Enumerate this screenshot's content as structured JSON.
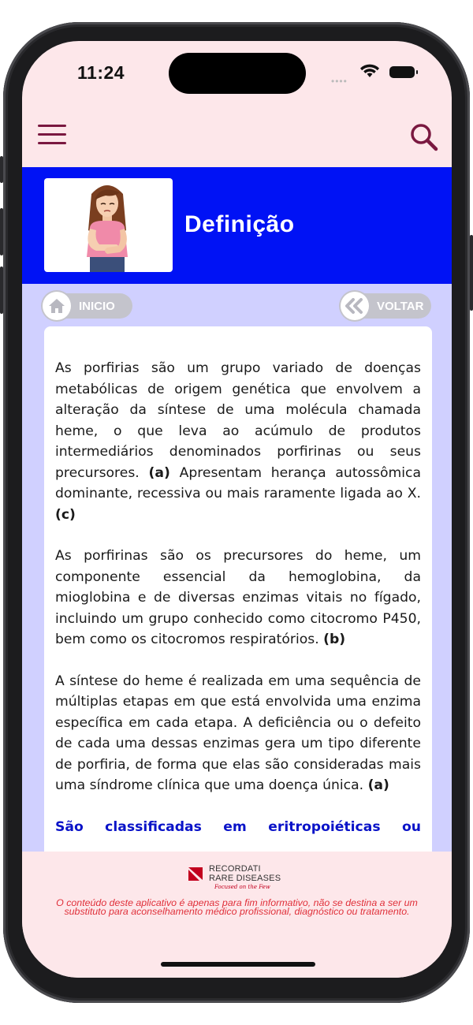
{
  "status_bar": {
    "time": "11:24"
  },
  "header": {
    "title": "Definição",
    "image_icon": "woman-stomach-pain-illustration"
  },
  "nav": {
    "home_label": "INICIO",
    "back_label": "VOLTAR"
  },
  "article": {
    "p1_text": "As porfirias são um grupo variado de doenças metabólicas de origem genética que envolvem a alteração da síntese de uma molécula chamada heme, o que leva ao acúmulo de produtos intermediários denominados porfirinas ou seus precursores.",
    "p1_ref1": "(a)",
    "p1_text2": "Apresentam herança autossômica dominante, recessiva ou mais raramente ligada ao X.",
    "p1_ref2": "(c)",
    "p2_text": "As porfirinas são os precursores do heme, um componente essencial da hemoglobina, da mioglobina e de diversas enzimas vitais no fígado, incluindo um grupo conhecido como citocromo P450, bem como os citocromos respiratórios.",
    "p2_ref": "(b)",
    "p3_text": "A síntese do heme é realizada em uma sequência de múltiplas etapas em que está envolvida uma enzima específica em cada etapa. A deficiência ou o defeito de cada uma dessas enzimas gera um tipo diferente de porfiria, de forma que elas são consideradas mais uma síndrome clínica que uma doença única.",
    "p3_ref": "(a)",
    "subheading": "São classificadas em eritropoiéticas ou"
  },
  "footer": {
    "logo_line1": "RECORDATI",
    "logo_line2": "RARE DISEASES",
    "logo_tagline": "Focused on the Few",
    "disclaimer": "O conteúdo deste aplicativo é apenas para fim informativo, não se destina a ser um substituto para aconselhamento médico profissional, diagnóstico ou tratamento."
  },
  "colors": {
    "app_background": "#fde7ea",
    "header_blue": "#0012f5",
    "content_lavender": "#d0d0ff",
    "accent_maroon": "#7a1840",
    "subheading_blue": "#0a13c8",
    "disclaimer_red": "#e0303a"
  }
}
